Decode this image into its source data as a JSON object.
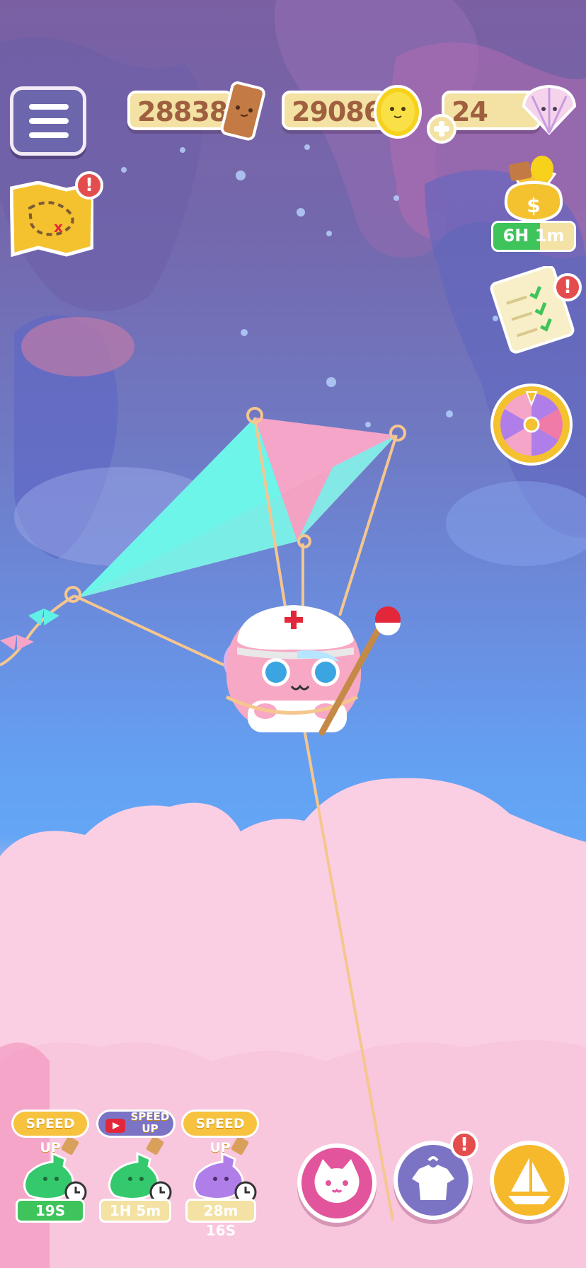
{
  "resources": {
    "wood": "28838",
    "coins": "29086",
    "shells": "24"
  },
  "offline_bag_timer": "6H 1m",
  "bottles": [
    {
      "tag": "SPEED UP",
      "timer": "19S",
      "color": "#2fc46a"
    },
    {
      "tag": "SPEED UP",
      "timer": "1H 5m",
      "color": "#2fc46a"
    },
    {
      "tag": "SPEED UP",
      "timer": "28m 16S",
      "color": "#b07ee8"
    }
  ],
  "alert": "!",
  "colors": {
    "menu": "#6c67ad",
    "resource_bg": "#f3e2a4",
    "alert": "#e44d4d",
    "cat_button": "#e2559c",
    "outfit_button": "#7b74c4",
    "boat_button": "#f6b92c"
  },
  "icons": [
    "menu-icon",
    "treasure-map-icon",
    "wood-plank-icon",
    "coin-icon",
    "plus-icon",
    "shell-icon",
    "money-bag-icon",
    "quest-list-icon",
    "prize-wheel-icon",
    "cat-face-icon",
    "shirt-icon",
    "sailboat-icon",
    "video-icon",
    "clock-icon"
  ]
}
